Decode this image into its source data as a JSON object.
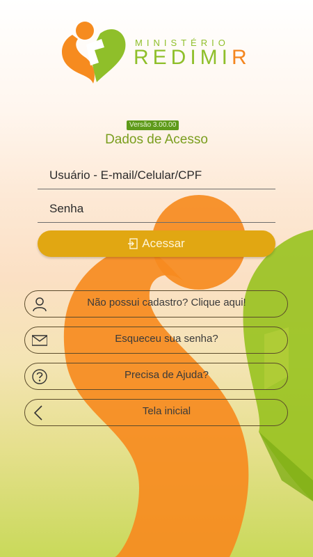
{
  "brand": {
    "subtitle": "MINISTÉRIO",
    "title_main": "REDIMI",
    "title_accent": "R",
    "colors": {
      "green": "#8fbf2a",
      "orange": "#f4861f",
      "gold": "#e1a712"
    }
  },
  "login": {
    "version": "Versão 3.00.00",
    "section_title": "Dados de Acesso",
    "user_placeholder": "Usuário - E-mail/Celular/CPF",
    "password_placeholder": "Senha",
    "submit_label": "Acessar",
    "submit_icon": "login-icon"
  },
  "links": [
    {
      "label": "Não possui cadastro? Clique aqui!",
      "icon": "user-icon"
    },
    {
      "label": "Esqueceu sua senha?",
      "icon": "mail-icon"
    },
    {
      "label": "Precisa de Ajuda?",
      "icon": "question-icon"
    },
    {
      "label": "Tela inicial",
      "icon": "chevron-left-icon"
    }
  ]
}
